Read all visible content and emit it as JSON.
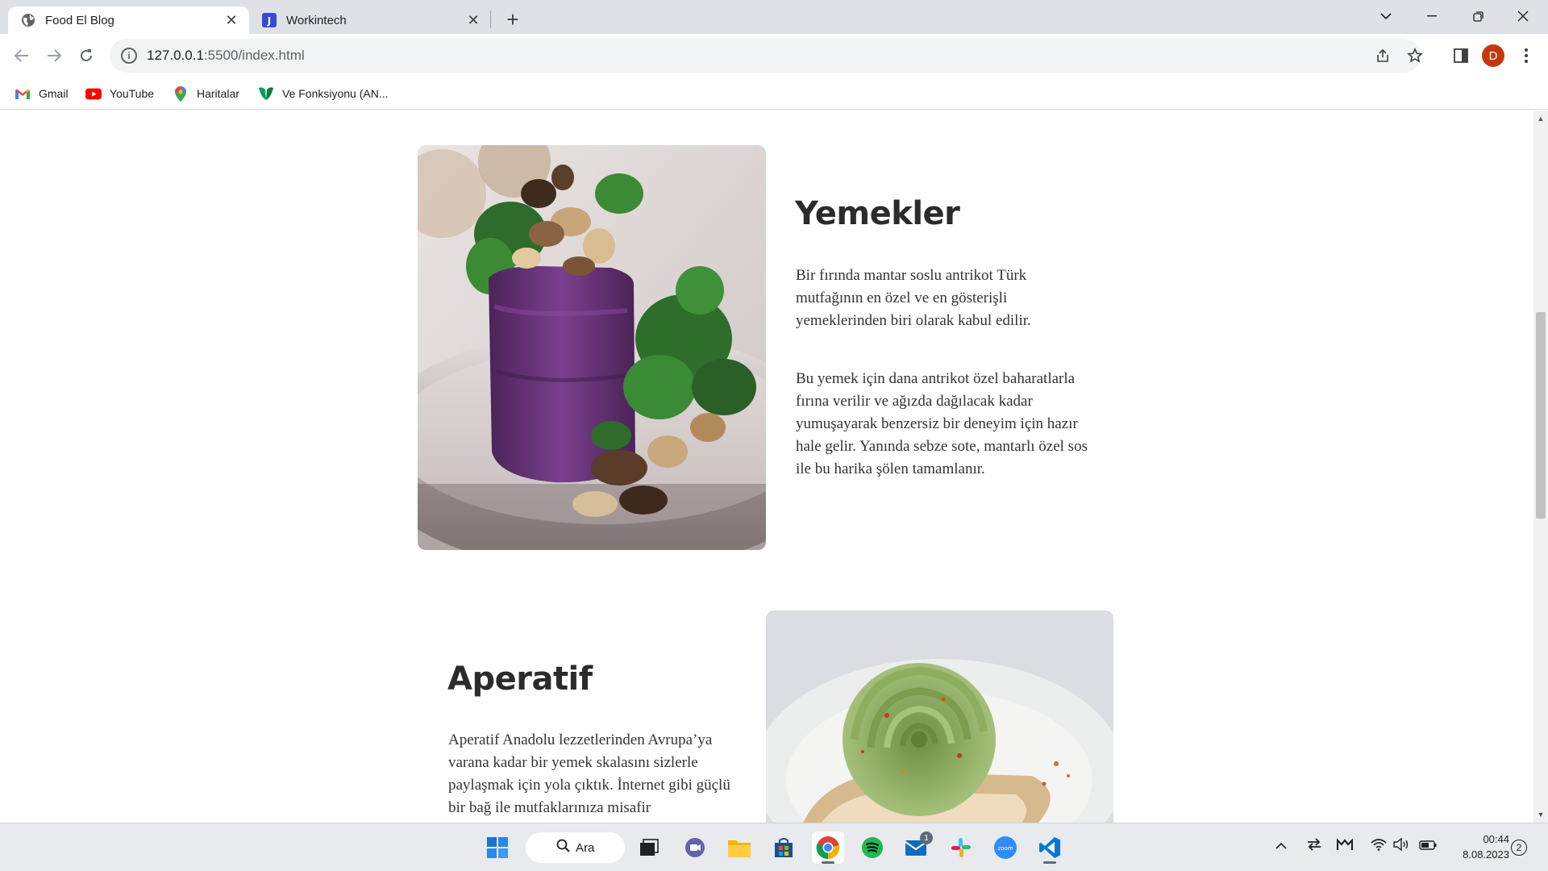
{
  "browser": {
    "tabs": [
      {
        "title": "Food El Blog",
        "icon": "globe-icon",
        "active": true
      },
      {
        "title": "Workintech",
        "icon": "workintech-icon",
        "active": false
      }
    ],
    "new_tab": "+",
    "url_host": "127.0.0.1",
    "url_rest": ":5500/index.html",
    "profile_initial": "D",
    "bookmarks": [
      {
        "label": "Gmail",
        "icon": "gmail-icon"
      },
      {
        "label": "YouTube",
        "icon": "youtube-icon"
      },
      {
        "label": "Haritalar",
        "icon": "maps-icon"
      },
      {
        "label": "Ve Fonksiyonu (AN...",
        "icon": "ve-fonksiyonu-icon"
      }
    ]
  },
  "page": {
    "sections": [
      {
        "title": "Yemekler",
        "paragraphs": [
          "Bir fırında mantar soslu antrikot Türk mutfağının en özel ve en gösterişli yemeklerinden biri olarak kabul edilir.",
          "Bu yemek için dana antrikot özel baharatlarla fırına verilir ve ağızda dağılacak kadar yumuşayarak benzersiz bir deneyim için hazır hale gelir. Yanında sebze sote, mantarlı özel sos ile bu harika şölen tamamlanır."
        ]
      },
      {
        "title": "Aperatif",
        "paragraphs": [
          "Aperatif Anadolu lezzetlerinden Avrupa’ya varana kadar bir yemek skalasını sizlerle paylaşmak için yola çıktık. İnternet gibi güçlü bir bağ ile mutfaklarınıza misafir"
        ]
      }
    ]
  },
  "taskbar": {
    "search_label": "Ara",
    "mail_badge": "1",
    "time": "00:44",
    "date": "8.08.2023",
    "notifications": "2"
  }
}
